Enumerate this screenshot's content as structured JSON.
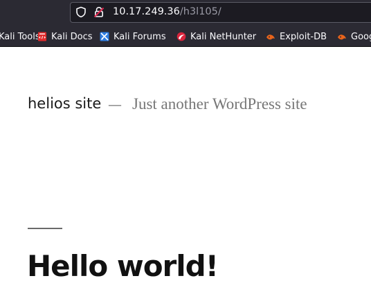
{
  "browser": {
    "url_host": "10.17.249.36",
    "url_path": "/h3l105/",
    "bookmarks": [
      {
        "label": "Kali Tools",
        "icon": "kali-tools-icon"
      },
      {
        "label": "Kali Docs",
        "icon": "kali-docs-icon"
      },
      {
        "label": "Kali Forums",
        "icon": "kali-forums-icon"
      },
      {
        "label": "Kali NetHunter",
        "icon": "kali-nethunter-icon"
      },
      {
        "label": "Exploit-DB",
        "icon": "exploit-db-icon"
      },
      {
        "label": "Google Hacking DB",
        "icon": "google-hacking-db-icon"
      }
    ],
    "colors": {
      "chrome_bg": "#2b2a33",
      "urlbar_bg": "#1c1b22",
      "text": "#fbfbfe"
    }
  },
  "page": {
    "site_title": "helios site",
    "separator": "—",
    "tagline": "Just another WordPress site",
    "post_title": "Hello world!"
  }
}
